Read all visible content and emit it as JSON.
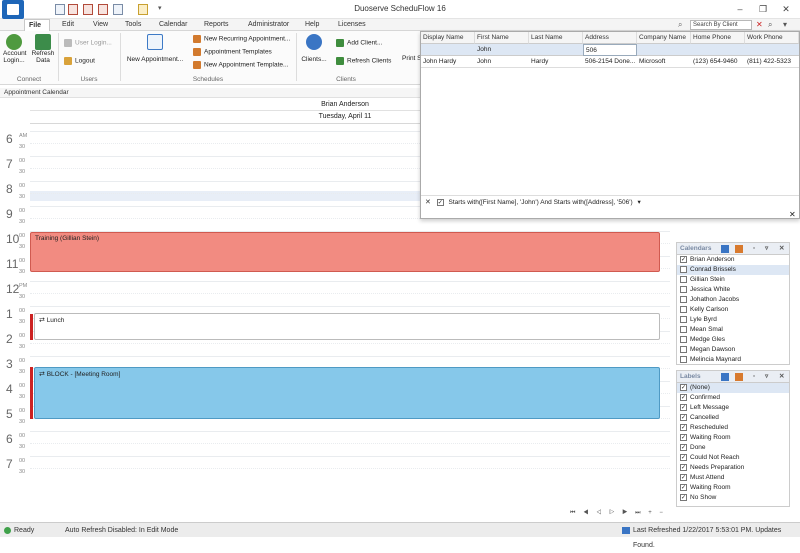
{
  "window": {
    "title": "Duoserve ScheduFlow 16"
  },
  "menu": [
    "File",
    "Edit",
    "View",
    "Tools",
    "Calendar",
    "Reports",
    "Administrator",
    "Help",
    "Licenses"
  ],
  "search": {
    "placeholder": "Search By Client"
  },
  "ribbon": {
    "account_login": "Account Login...",
    "refresh_data": "Refresh Data",
    "user_login": "User Login...",
    "logout": "Logout",
    "new_appointment": "New Appointment...",
    "new_recurring": "New Recurring Appointment...",
    "appointment_templates": "Appointment Templates",
    "new_appointment_template": "New Appointment Template...",
    "clients": "Clients...",
    "add_client": "Add Client...",
    "refresh_clients": "Refresh Clients",
    "print": "Print S...",
    "groups": {
      "connect": "Connect",
      "users": "Users",
      "schedules": "Schedules",
      "clients": "Clients"
    }
  },
  "calendar": {
    "label": "Appointment Calendar",
    "resource": "Brian Anderson",
    "date": "Tuesday, April 11",
    "hours": [
      {
        "h": "6",
        "m": "AM"
      },
      {
        "h": "7",
        "m": "00"
      },
      {
        "h": "8",
        "m": "00"
      },
      {
        "h": "9",
        "m": "00"
      },
      {
        "h": "10",
        "m": "00"
      },
      {
        "h": "11",
        "m": "00"
      },
      {
        "h": "12",
        "m": "PM"
      },
      {
        "h": "1",
        "m": "00"
      },
      {
        "h": "2",
        "m": "00"
      },
      {
        "h": "3",
        "m": "00"
      },
      {
        "h": "4",
        "m": "00"
      },
      {
        "h": "5",
        "m": "00"
      },
      {
        "h": "6",
        "m": "00"
      },
      {
        "h": "7",
        "m": "00"
      }
    ],
    "half_label": "30",
    "appointments": [
      {
        "title": "Training (Gillian Stein)"
      },
      {
        "title": "Lunch"
      },
      {
        "title": "BLOCK - [Meeting Room]"
      }
    ]
  },
  "client_grid": {
    "columns": [
      "Display Name",
      "First Name",
      "Last Name",
      "Address",
      "Company Name",
      "Home Phone",
      "Work Phone"
    ],
    "filter_row": [
      "",
      "John",
      "",
      "506",
      "",
      "",
      ""
    ],
    "rows": [
      [
        "John Hardy",
        "John",
        "Hardy",
        "506-2154 Done...",
        "Microsoft",
        "(123) 654-9460",
        "(811) 422-5323"
      ]
    ],
    "filter_text": "Starts with([First Name], 'John') And Starts with([Address], '506')"
  },
  "calendars_panel": {
    "title": "Calendars",
    "items": [
      {
        "name": "Brian Anderson",
        "checked": true
      },
      {
        "name": "Conrad Brissels",
        "checked": false
      },
      {
        "name": "Gillian Stein",
        "checked": false
      },
      {
        "name": "Jessica White",
        "checked": false
      },
      {
        "name": "Johathon Jacobs",
        "checked": false
      },
      {
        "name": "Kelly Carlson",
        "checked": false
      },
      {
        "name": "Lyle Byrd",
        "checked": false
      },
      {
        "name": "Mean Smal",
        "checked": false
      },
      {
        "name": "Medge Gles",
        "checked": false
      },
      {
        "name": "Megan Dawson",
        "checked": false
      },
      {
        "name": "Melincia Maynard",
        "checked": false
      }
    ]
  },
  "labels_panel": {
    "title": "Labels",
    "items": [
      {
        "name": "(None)",
        "checked": true
      },
      {
        "name": "Confirmed",
        "checked": true
      },
      {
        "name": "Left Message",
        "checked": true
      },
      {
        "name": "Cancelled",
        "checked": true
      },
      {
        "name": "Rescheduled",
        "checked": true
      },
      {
        "name": "Waiting Room",
        "checked": true
      },
      {
        "name": "Done",
        "checked": true
      },
      {
        "name": "Could Not Reach",
        "checked": true
      },
      {
        "name": "Needs Preparation",
        "checked": true
      },
      {
        "name": "Must Attend",
        "checked": true
      },
      {
        "name": "Waiting Room",
        "checked": true
      },
      {
        "name": "No Show",
        "checked": true
      }
    ]
  },
  "status": {
    "ready": "Ready",
    "refresh": "Auto Refresh Disabled: In Edit Mode",
    "last_refreshed": "Last Refreshed 1/22/2017 5:53:01 PM. Updates Found."
  },
  "colors": {
    "training": "#f28b81",
    "block": "#86c8ea",
    "accent": "#1e66b8",
    "red_bar": "#cc2222"
  }
}
